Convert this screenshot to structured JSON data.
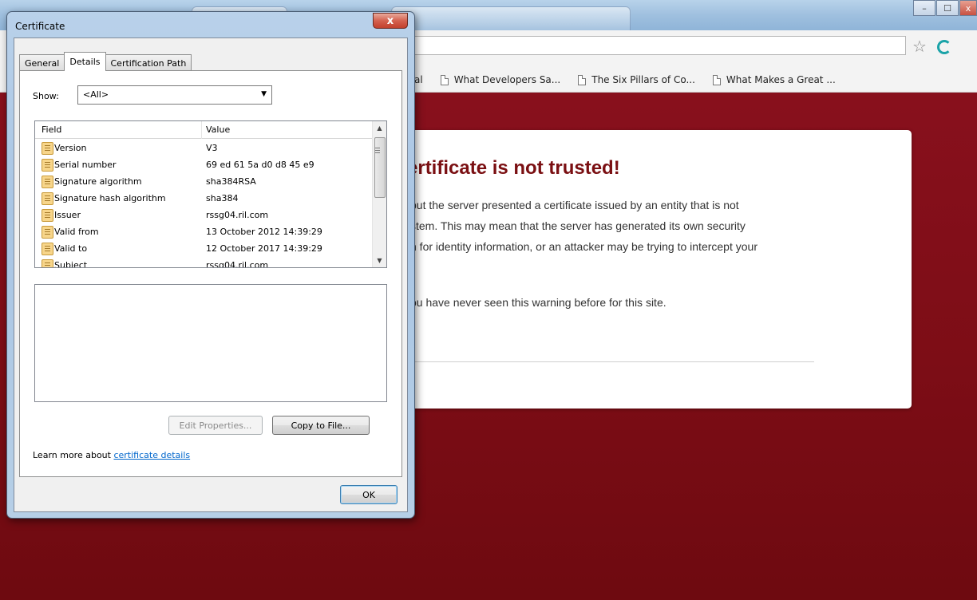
{
  "browser": {
    "bookmarks": [
      {
        "label": "al"
      },
      {
        "label": "What Developers Sa..."
      },
      {
        "label": "The Six Pillars of Co..."
      },
      {
        "label": "What Makes a Great ..."
      }
    ],
    "window_controls": {
      "minimize": "–",
      "maximize": "☐",
      "close": "x"
    }
  },
  "interstitial": {
    "title": "ertificate is not trusted!",
    "lines": [
      " but the server presented a certificate issued by an entity that is not",
      "stem. This may mean that the server has generated its own security",
      "n for identity information, or an attacker may be trying to intercept your",
      "ou have never seen this warning before for this site."
    ]
  },
  "dialog": {
    "title": "Certificate",
    "close_label": "x",
    "tabs": [
      "General",
      "Details",
      "Certification Path"
    ],
    "active_tab": "Details",
    "show_label": "Show:",
    "show_value": "<All>",
    "columns": {
      "field": "Field",
      "value": "Value"
    },
    "rows": [
      {
        "field": "Version",
        "value": "V3"
      },
      {
        "field": "Serial number",
        "value": "69 ed 61 5a d0 d8 45 e9"
      },
      {
        "field": "Signature algorithm",
        "value": "sha384RSA"
      },
      {
        "field": "Signature hash algorithm",
        "value": "sha384"
      },
      {
        "field": "Issuer",
        "value": "rssg04.ril.com"
      },
      {
        "field": "Valid from",
        "value": "13 October 2012 14:39:29"
      },
      {
        "field": "Valid to",
        "value": "12 October 2017 14:39:29"
      },
      {
        "field": "Subject",
        "value": "rssg04.ril.com"
      }
    ],
    "edit_properties_label": "Edit Properties...",
    "copy_to_file_label": "Copy to File...",
    "learn_more_prefix": "Learn more about ",
    "learn_more_link": "certificate details",
    "ok_label": "OK"
  }
}
